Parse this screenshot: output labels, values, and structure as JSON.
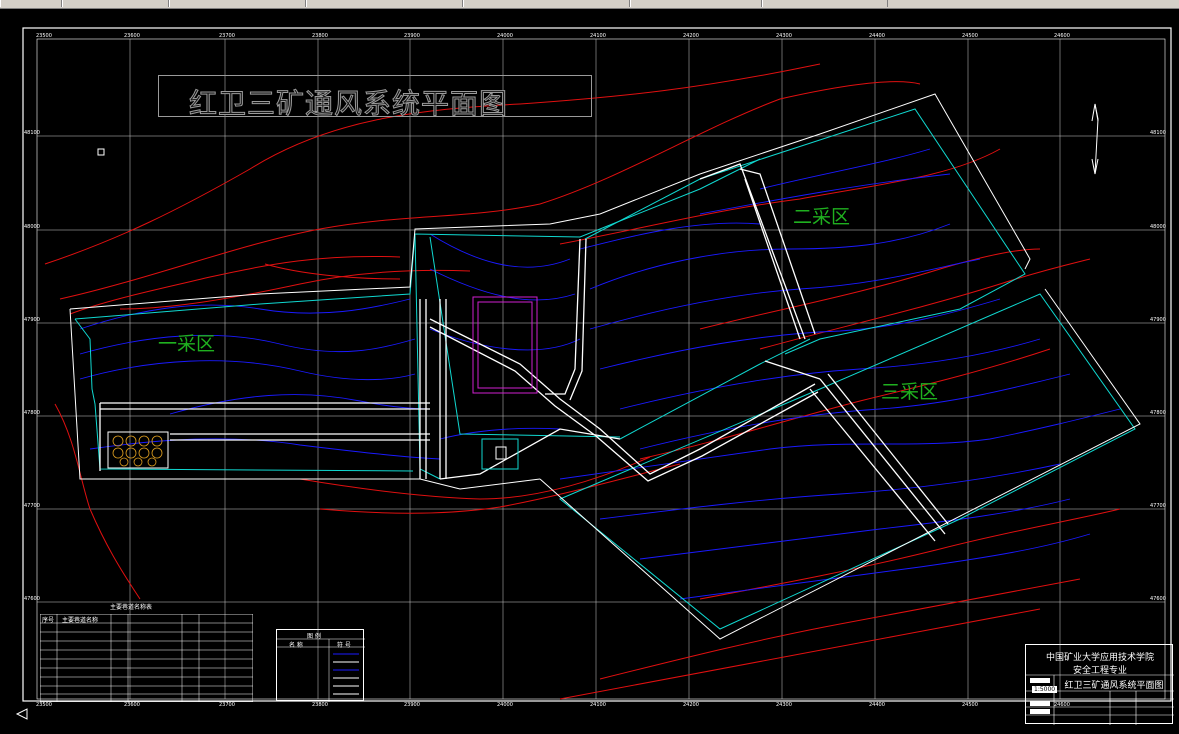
{
  "window": {
    "app": "CAD viewer"
  },
  "drawing": {
    "title": "红卫三矿通风系统平面图",
    "zones": {
      "zone1": "一采区",
      "zone2": "二采区",
      "zone3": "三采区"
    }
  },
  "title_block": {
    "school": "中国矿业大学应用技术学院",
    "major": "安全工程专业",
    "drawing_name": "红卫三矿通风系统平面图",
    "scale": "1:5000"
  },
  "legend": {
    "heading": "图 例",
    "col_name": "名 称",
    "col_symbol": "符 号"
  },
  "project_table": {
    "heading": "主要巷道名称表",
    "col_no": "序号",
    "col_name": "主要巷道名称"
  },
  "grid_labels": {
    "top": [
      "23500",
      "23600",
      "23700",
      "23800",
      "23900",
      "24000",
      "24100",
      "24200",
      "24300",
      "24400",
      "24500",
      "24600"
    ],
    "bottom": [
      "23500",
      "23600",
      "23700",
      "23800",
      "23900",
      "24000",
      "24100",
      "24200",
      "24300",
      "24400",
      "24500",
      "24600"
    ],
    "right": [
      "48100",
      "48000",
      "47900",
      "47800",
      "47700",
      "47600"
    ],
    "left": [
      "48100",
      "48000",
      "47900",
      "47800",
      "47700",
      "47600"
    ]
  },
  "colors": {
    "frame": "#ffffff",
    "contour": "#1a1aff",
    "fault": "#e01010",
    "boundary": "#10d8d0",
    "roadway": "#ffffff",
    "label_green": "#1fb01f",
    "magenta": "#d020d0"
  }
}
